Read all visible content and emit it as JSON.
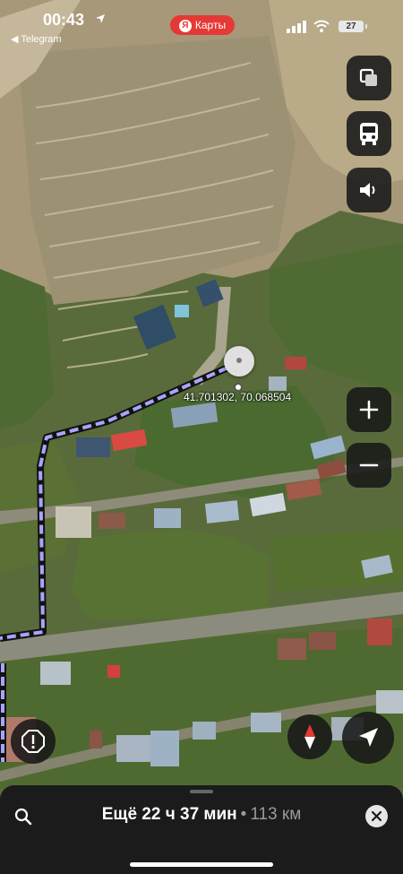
{
  "status_bar": {
    "time": "00:43",
    "back_app": "Telegram",
    "app_pill": "Карты",
    "app_logo": "Я",
    "battery": "27"
  },
  "map": {
    "coordinates": "41.701302, 70.068504"
  },
  "controls": {
    "layers_icon": "layers-icon",
    "transport_icon": "bus-icon",
    "sound_icon": "speaker-icon",
    "zoom_in_icon": "plus-icon",
    "zoom_out_icon": "minus-icon",
    "report_icon": "alert-octagon-icon",
    "compass_icon": "compass-icon",
    "my_location_icon": "navigation-arrow-icon"
  },
  "route_sheet": {
    "remaining_label": "Ещё",
    "remaining_time": "22 ч 37 мин",
    "distance": "113 км",
    "separator": "•",
    "search_icon": "search-icon",
    "close_icon": "close-icon"
  },
  "colors": {
    "route": "#a9a4ff",
    "pill": "#e53935",
    "panel": "#1b1b1b"
  }
}
